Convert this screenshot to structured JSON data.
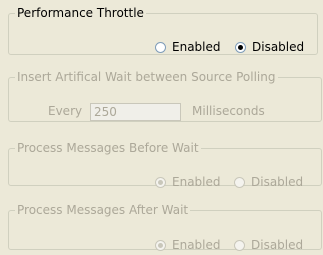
{
  "performance_throttle": {
    "title": "Performance Throttle",
    "enabled_label": "Enabled",
    "disabled_label": "Disabled",
    "selected": "Disabled"
  },
  "artificial_wait": {
    "title": "Insert Artifical Wait between Source Polling",
    "every_label": "Every",
    "value": "250",
    "unit_label": "Milliseconds"
  },
  "process_before_wait": {
    "title": "Process Messages Before Wait",
    "enabled_label": "Enabled",
    "disabled_label": "Disabled",
    "selected": "Enabled"
  },
  "process_after_wait": {
    "title": "Process Messages After Wait",
    "enabled_label": "Enabled",
    "disabled_label": "Disabled",
    "selected": "Enabled"
  }
}
